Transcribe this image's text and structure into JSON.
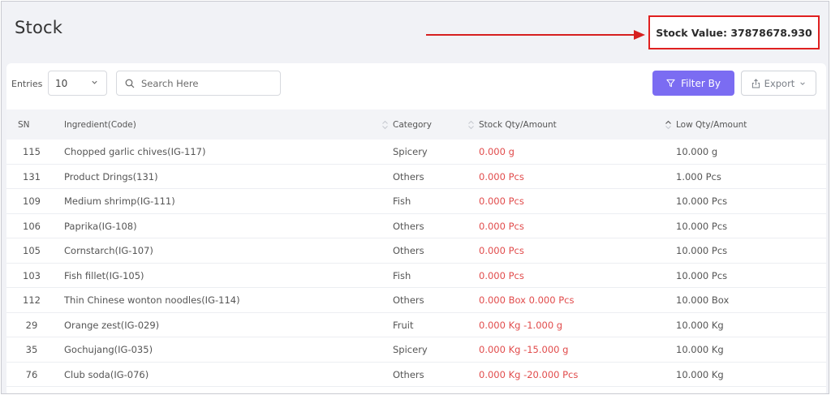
{
  "page": {
    "title": "Stock"
  },
  "stock_value": {
    "label": "Stock Value: 37878678.930"
  },
  "toolbar": {
    "entries_label": "Entries",
    "entries_value": "10",
    "search_placeholder": "Search Here",
    "filter_label": "Filter By",
    "export_label": "Export"
  },
  "table": {
    "headers": {
      "sn": "SN",
      "ingredient": "Ingredient(Code)",
      "category": "Category",
      "stock": "Stock Qty/Amount",
      "low": "Low Qty/Amount"
    },
    "rows": [
      {
        "sn": "115",
        "ingredient": "Chopped garlic chives(IG-117)",
        "category": "Spicery",
        "stock": "0.000 g",
        "low": "10.000 g"
      },
      {
        "sn": "131",
        "ingredient": "Product Drings(131)",
        "category": "Others",
        "stock": "0.000 Pcs",
        "low": "1.000 Pcs"
      },
      {
        "sn": "109",
        "ingredient": "Medium shrimp(IG-111)",
        "category": "Fish",
        "stock": "0.000 Pcs",
        "low": "10.000 Pcs"
      },
      {
        "sn": "106",
        "ingredient": "Paprika(IG-108)",
        "category": "Others",
        "stock": "0.000 Pcs",
        "low": "10.000 Pcs"
      },
      {
        "sn": "105",
        "ingredient": "Cornstarch(IG-107)",
        "category": "Others",
        "stock": "0.000 Pcs",
        "low": "10.000 Pcs"
      },
      {
        "sn": "103",
        "ingredient": "Fish fillet(IG-105)",
        "category": "Fish",
        "stock": "0.000 Pcs",
        "low": "10.000 Pcs"
      },
      {
        "sn": "112",
        "ingredient": "Thin Chinese wonton noodles(IG-114)",
        "category": "Others",
        "stock": "0.000 Box 0.000 Pcs",
        "low": "10.000 Box"
      },
      {
        "sn": "29",
        "ingredient": "Orange zest(IG-029)",
        "category": "Fruit",
        "stock": "0.000 Kg -1.000 g",
        "low": "10.000 Kg"
      },
      {
        "sn": "35",
        "ingredient": "Gochujang(IG-035)",
        "category": "Spicery",
        "stock": "0.000 Kg -15.000 g",
        "low": "10.000 Kg"
      },
      {
        "sn": "76",
        "ingredient": "Club soda(IG-076)",
        "category": "Others",
        "stock": "0.000 Kg -20.000 Pcs",
        "low": "10.000 Kg"
      }
    ]
  },
  "colors": {
    "accent": "#7b6cf2",
    "stock_low_text": "#e14b4b",
    "highlight_box": "#e02020"
  },
  "icons": {
    "search": "search-icon",
    "filter": "filter-icon",
    "export": "export-icon",
    "sort": "sort-icon",
    "dropdown": "chevron-down-icon",
    "annotation_arrow": "arrow-right-icon"
  }
}
